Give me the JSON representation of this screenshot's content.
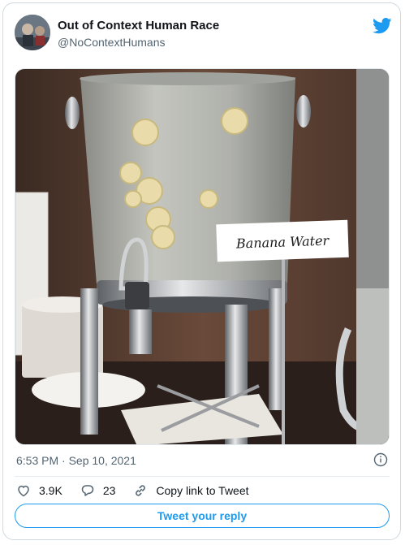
{
  "author": {
    "name": "Out of Context Human Race",
    "handle": "@NoContextHumans"
  },
  "media": {
    "sign_text": "Banana Water"
  },
  "meta": {
    "timestamp": "6:53 PM · Sep 10, 2021"
  },
  "actions": {
    "likes": "3.9K",
    "replies": "23",
    "copy_link_label": "Copy link to Tweet"
  },
  "reply_button": {
    "label": "Tweet your reply"
  },
  "colors": {
    "accent": "#1d9bf0",
    "like_icon": "#e0245e",
    "secondary_text": "#536471",
    "border": "#cfd9de"
  },
  "icons": [
    "twitter-bird-icon",
    "info-icon",
    "heart-icon",
    "reply-bubble-icon",
    "link-icon"
  ]
}
